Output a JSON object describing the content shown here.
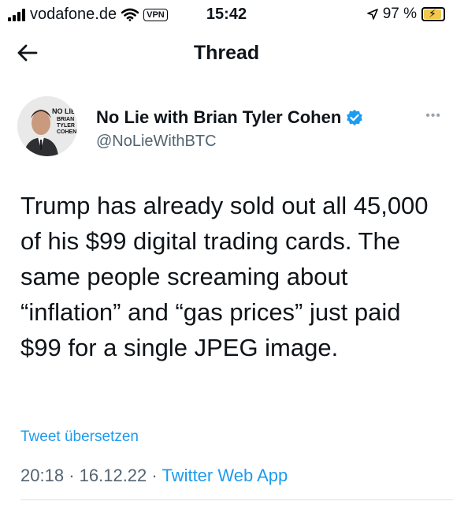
{
  "status_bar": {
    "carrier": "vodafone.de",
    "vpn": "VPN",
    "time": "15:42",
    "battery": "97 %",
    "icons": [
      "signal-icon",
      "wifi-icon",
      "location-arrow-icon",
      "battery-charging-icon"
    ]
  },
  "nav": {
    "title": "Thread",
    "back_icon": "arrow-left-icon"
  },
  "tweet": {
    "author_name": "No Lie with Brian Tyler Cohen",
    "handle": "@NoLieWithBTC",
    "verified": true,
    "avatar_text": {
      "line1": "NO LIE",
      "line2": "BRIAN",
      "line3": "TYLER",
      "line4": "COHEN"
    },
    "text": "Trump has already sold out all 45,000 of his $99 digital trading cards. The same people screaming about “inflation” and “gas prices” just paid $99 for a single JPEG image.",
    "translate_label": "Tweet übersetzen",
    "time": "20:18",
    "date": "16.12.22",
    "source": "Twitter Web App",
    "separator": "·"
  },
  "colors": {
    "accent": "#1d9bf0",
    "secondary_text": "#536471",
    "battery_fill": "#f2c94c"
  }
}
